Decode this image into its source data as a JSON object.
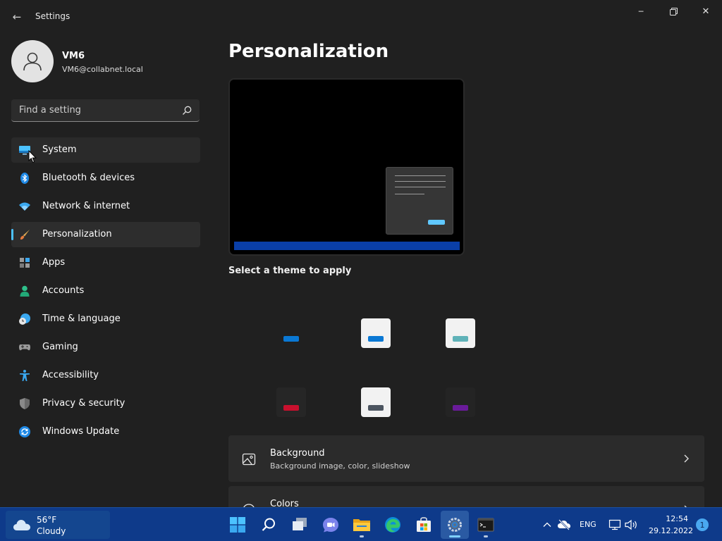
{
  "window": {
    "title": "Settings",
    "back_glyph": "←",
    "minimize_glyph": "─",
    "close_glyph": "✕"
  },
  "user": {
    "name": "VM6",
    "email": "VM6@collabnet.local"
  },
  "search": {
    "placeholder": "Find a setting"
  },
  "nav": {
    "items": [
      {
        "label": "System",
        "icon": "monitor-icon"
      },
      {
        "label": "Bluetooth & devices",
        "icon": "bluetooth-icon"
      },
      {
        "label": "Network & internet",
        "icon": "wifi-icon"
      },
      {
        "label": "Personalization",
        "icon": "brush-icon"
      },
      {
        "label": "Apps",
        "icon": "apps-icon"
      },
      {
        "label": "Accounts",
        "icon": "person-icon"
      },
      {
        "label": "Time & language",
        "icon": "clock-globe-icon"
      },
      {
        "label": "Gaming",
        "icon": "gamepad-icon"
      },
      {
        "label": "Accessibility",
        "icon": "accessibility-icon"
      },
      {
        "label": "Privacy & security",
        "icon": "shield-icon"
      },
      {
        "label": "Windows Update",
        "icon": "update-icon"
      }
    ],
    "selected": "Personalization",
    "hovered": "System"
  },
  "main": {
    "title": "Personalization",
    "theme_heading": "Select a theme to apply",
    "themes": [
      {
        "tile": "#202020",
        "accent": "#0a78d4"
      },
      {
        "tile": "#f2f2f2",
        "accent": "#0a78d4"
      },
      {
        "tile": "#f2f2f2",
        "accent": "#5fb2b8"
      },
      {
        "tile": "#262626",
        "accent": "#c8102e"
      },
      {
        "tile": "#f2f2f2",
        "accent": "#4c5560"
      },
      {
        "tile": "#242424",
        "accent": "#6a1b9a"
      }
    ],
    "cards": [
      {
        "title": "Background",
        "subtitle": "Background image, color, slideshow",
        "icon": "image-icon"
      },
      {
        "title": "Colors",
        "subtitle": "",
        "icon": "palette-icon"
      }
    ]
  },
  "taskbar": {
    "weather_temp": "56°F",
    "weather_desc": "Cloudy",
    "language": "ENG",
    "time": "12:54",
    "date": "29.12.2022",
    "notification_count": "1",
    "pinned": [
      "start-icon",
      "search-icon",
      "task-view-icon",
      "chat-icon",
      "file-explorer-icon",
      "edge-icon",
      "store-icon",
      "settings-icon",
      "terminal-icon"
    ],
    "active": "settings-icon"
  },
  "colors": {
    "accent": "#4cc2ff",
    "taskbar": "#0e3a8a"
  }
}
